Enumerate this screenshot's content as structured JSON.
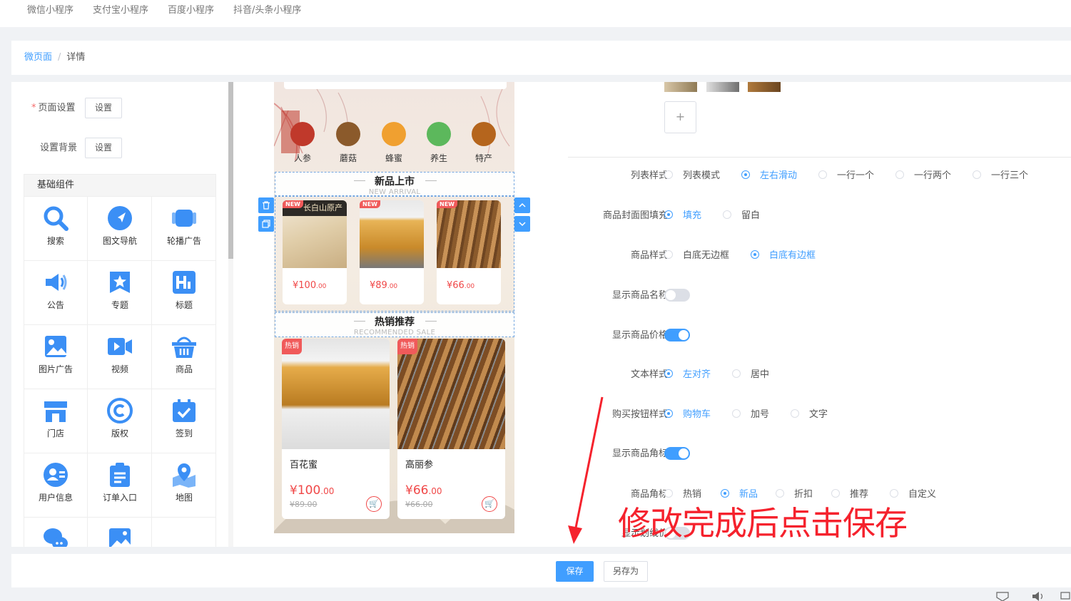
{
  "top_tabs": [
    "微信小程序",
    "支付宝小程序",
    "百度小程序",
    "抖音/头条小程序"
  ],
  "breadcrumb": {
    "parent": "微页面",
    "separator": "/",
    "current": "详情"
  },
  "page_settings": {
    "page_setting_label": "页面设置",
    "page_setting_btn": "设置",
    "bg_setting_label": "设置背景",
    "bg_setting_btn": "设置"
  },
  "components": {
    "title": "基础组件",
    "items": [
      {
        "label": "搜索",
        "icon": "search-icon"
      },
      {
        "label": "图文导航",
        "icon": "navigation-icon"
      },
      {
        "label": "轮播广告",
        "icon": "carousel-icon"
      },
      {
        "label": "公告",
        "icon": "megaphone-icon"
      },
      {
        "label": "专题",
        "icon": "star-bookmark-icon"
      },
      {
        "label": "标题",
        "icon": "heading-icon"
      },
      {
        "label": "图片广告",
        "icon": "image-icon"
      },
      {
        "label": "视频",
        "icon": "video-icon"
      },
      {
        "label": "商品",
        "icon": "basket-icon"
      },
      {
        "label": "门店",
        "icon": "store-icon"
      },
      {
        "label": "版权",
        "icon": "copyright-icon"
      },
      {
        "label": "签到",
        "icon": "calendar-check-icon"
      },
      {
        "label": "用户信息",
        "icon": "user-icon"
      },
      {
        "label": "订单入口",
        "icon": "clipboard-icon"
      },
      {
        "label": "地图",
        "icon": "map-pin-icon"
      },
      {
        "label": "",
        "icon": "chat-icon"
      },
      {
        "label": "",
        "icon": "picture-icon"
      }
    ]
  },
  "preview": {
    "nav": [
      {
        "label": "人参",
        "color": "#c0392b"
      },
      {
        "label": "蘑菇",
        "color": "#8b5a2b"
      },
      {
        "label": "蜂蜜",
        "color": "#f0a030"
      },
      {
        "label": "养生",
        "color": "#5cb85c"
      },
      {
        "label": "特产",
        "color": "#b5651d"
      }
    ],
    "new_section": {
      "title": "新品上市",
      "subtitle": "NEW ARRIVAL"
    },
    "new_products": [
      {
        "tag": "NEW",
        "price_main": "¥100",
        "price_dec": ".00",
        "image_text": "长白山原产"
      },
      {
        "tag": "NEW",
        "price_main": "¥89",
        "price_dec": ".00"
      },
      {
        "tag": "NEW",
        "price_main": "¥66",
        "price_dec": ".00"
      }
    ],
    "hot_section": {
      "title": "热销推荐",
      "subtitle": "RECOMMENDED SALE"
    },
    "hot_products": [
      {
        "tag": "热销",
        "name": "百花蜜",
        "price_main": "¥100",
        "price_dec": ".00",
        "old_price": "¥89.00"
      },
      {
        "tag": "热销",
        "name": "高丽参",
        "price_main": "¥66",
        "price_dec": ".00",
        "old_price": "¥66.00"
      }
    ]
  },
  "settings": {
    "list_style": {
      "label": "列表样式",
      "options": [
        "列表模式",
        "左右滑动",
        "一行一个",
        "一行两个",
        "一行三个"
      ],
      "selected": "左右滑动"
    },
    "cover_fill": {
      "label": "商品封面图填充",
      "options": [
        "填充",
        "留白"
      ],
      "selected": "填充"
    },
    "product_style": {
      "label": "商品样式",
      "options": [
        "白底无边框",
        "白底有边框"
      ],
      "selected": "白底有边框"
    },
    "show_name": {
      "label": "显示商品名称",
      "on": false
    },
    "show_price": {
      "label": "显示商品价格",
      "on": true
    },
    "text_style": {
      "label": "文本样式",
      "options": [
        "左对齐",
        "居中"
      ],
      "selected": "左对齐"
    },
    "buy_button": {
      "label": "购买按钮样式",
      "options": [
        "购物车",
        "加号",
        "文字"
      ],
      "selected": "购物车"
    },
    "show_badge": {
      "label": "显示商品角标",
      "on": true
    },
    "badge": {
      "label": "商品角标",
      "options": [
        "热销",
        "新品",
        "折扣",
        "推荐",
        "自定义"
      ],
      "selected": "新品"
    },
    "show_strike": {
      "label": "显示划线价",
      "on": false
    }
  },
  "add_image_symbol": "+",
  "annotation": "修改完成后点击保存",
  "footer": {
    "save": "保存",
    "save_as": "另存为"
  },
  "colors": {
    "accent": "#409eff",
    "price": "#f04848",
    "annotation": "#f5222d"
  }
}
